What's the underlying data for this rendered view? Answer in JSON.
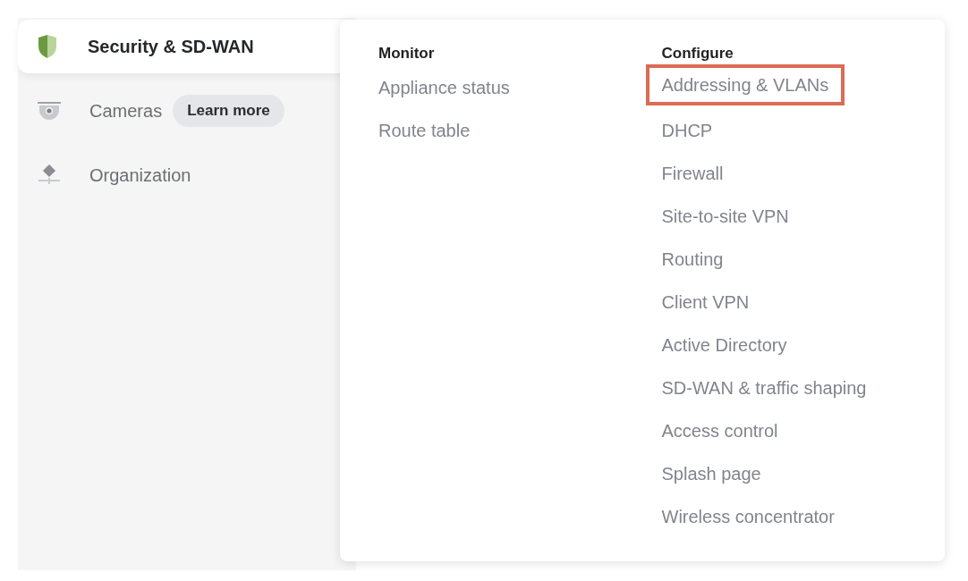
{
  "sidebar": {
    "items": [
      {
        "label": "Security & SD-WAN",
        "selected": true
      },
      {
        "label": "Cameras",
        "selected": false,
        "badge": "Learn more"
      },
      {
        "label": "Organization",
        "selected": false
      }
    ]
  },
  "flyout": {
    "columns": [
      {
        "heading": "Monitor",
        "items": [
          {
            "label": "Appliance status",
            "highlighted": false
          },
          {
            "label": "Route table",
            "highlighted": false
          }
        ]
      },
      {
        "heading": "Configure",
        "items": [
          {
            "label": "Addressing & VLANs",
            "highlighted": true
          },
          {
            "label": "DHCP",
            "highlighted": false
          },
          {
            "label": "Firewall",
            "highlighted": false
          },
          {
            "label": "Site-to-site VPN",
            "highlighted": false
          },
          {
            "label": "Routing",
            "highlighted": false
          },
          {
            "label": "Client VPN",
            "highlighted": false
          },
          {
            "label": "Active Directory",
            "highlighted": false
          },
          {
            "label": "SD-WAN & traffic shaping",
            "highlighted": false
          },
          {
            "label": "Access control",
            "highlighted": false
          },
          {
            "label": "Splash page",
            "highlighted": false
          },
          {
            "label": "Wireless concentrator",
            "highlighted": false
          }
        ]
      }
    ]
  }
}
